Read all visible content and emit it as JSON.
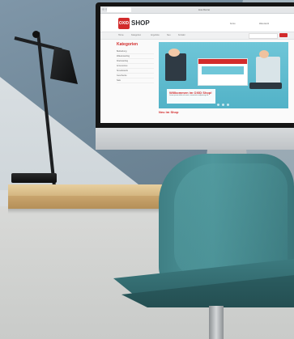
{
  "scene": {
    "description_colors": {
      "wall_blue": "#6f8798",
      "desk_wood": "#d4b680",
      "chair_teal": "#4f979c",
      "brand_red": "#d22b2b"
    }
  },
  "screen": {
    "browser_title": "Live Demo",
    "logo_mark": "OXID",
    "logo_text": "SHOP",
    "header_links": [
      "Konto",
      "Warenkorb"
    ],
    "nav_items": [
      "Home",
      "Kategorien",
      "Angebote",
      "Neu",
      "Kontakt"
    ],
    "sidebar_title": "Kategorien",
    "sidebar_items": [
      "Bekleidung",
      "Wakeboarding",
      "Kiteboarding",
      "Accessoires",
      "Snowboards",
      "Geschenke",
      "Sale"
    ],
    "banner_title": "Willkommen im OXID Shop!",
    "banner_text": "Lorem ipsum dolor sit amet, consectetur adipiscing elit.",
    "section_title": "Neu im Shop"
  }
}
